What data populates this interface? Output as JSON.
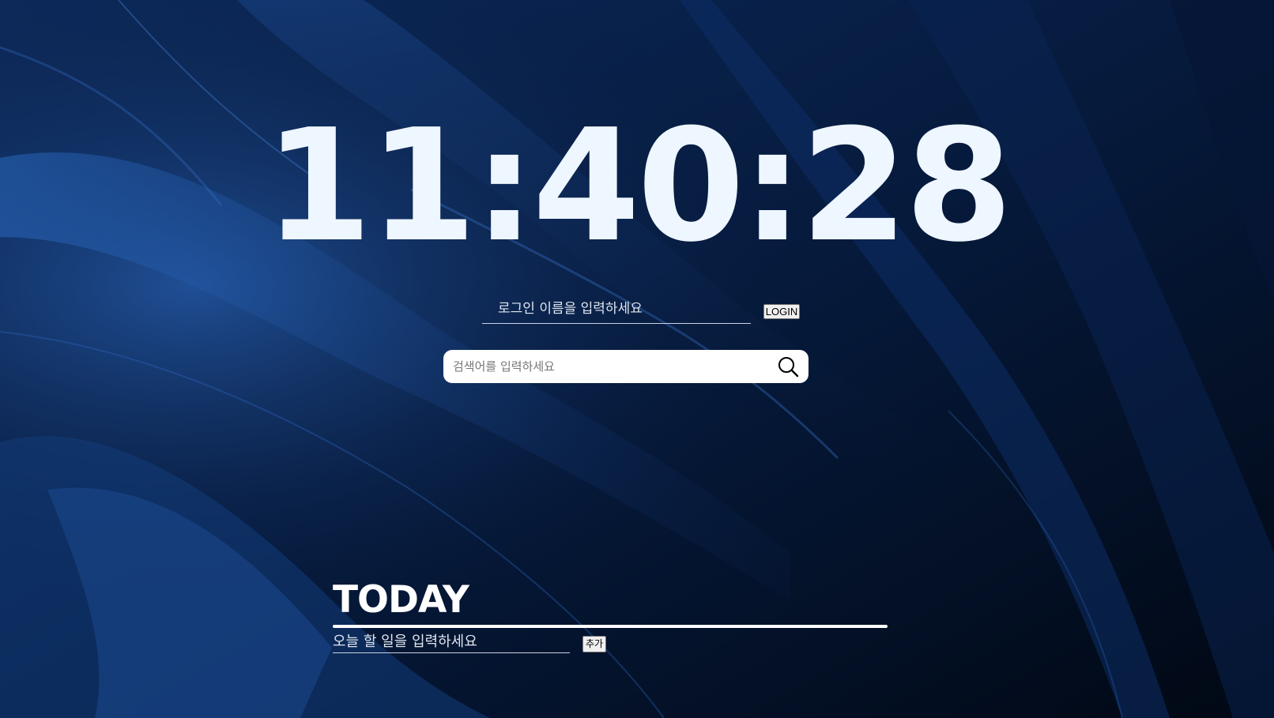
{
  "clock": {
    "time": "11:40:28"
  },
  "login": {
    "placeholder": "로그인 이름을 입력하세요",
    "button_label": "LOGIN"
  },
  "search": {
    "placeholder": "검색어를 입력하세요",
    "icon": "search-icon"
  },
  "today": {
    "title": "TODAY",
    "todo_placeholder": "오늘 할 일을 입력하세요",
    "add_label": "추가"
  },
  "colors": {
    "background": "#03102a",
    "accent_blue": "#1f4f9a",
    "text": "#eef6ff"
  }
}
